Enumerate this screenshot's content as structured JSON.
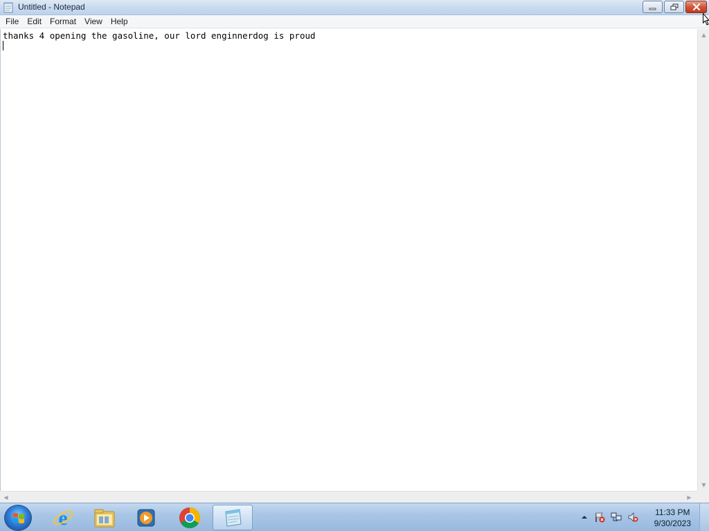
{
  "window": {
    "title": "Untitled - Notepad",
    "colors": {
      "titlebar": "#c9dbef",
      "close_button": "#c4391b",
      "editor_bg": "#ffffff"
    }
  },
  "menubar": {
    "items": [
      {
        "label": "File"
      },
      {
        "label": "Edit"
      },
      {
        "label": "Format"
      },
      {
        "label": "View"
      },
      {
        "label": "Help"
      }
    ]
  },
  "editor": {
    "content": "thanks 4 opening the gasoline, our lord enginnerdog is proud"
  },
  "taskbar": {
    "apps": [
      {
        "name": "internet-explorer-icon"
      },
      {
        "name": "file-explorer-icon"
      },
      {
        "name": "media-player-icon"
      },
      {
        "name": "chrome-icon"
      },
      {
        "name": "notepad-icon",
        "active": true
      }
    ],
    "clock": {
      "time": "11:33 PM",
      "date": "9/30/2023"
    }
  }
}
